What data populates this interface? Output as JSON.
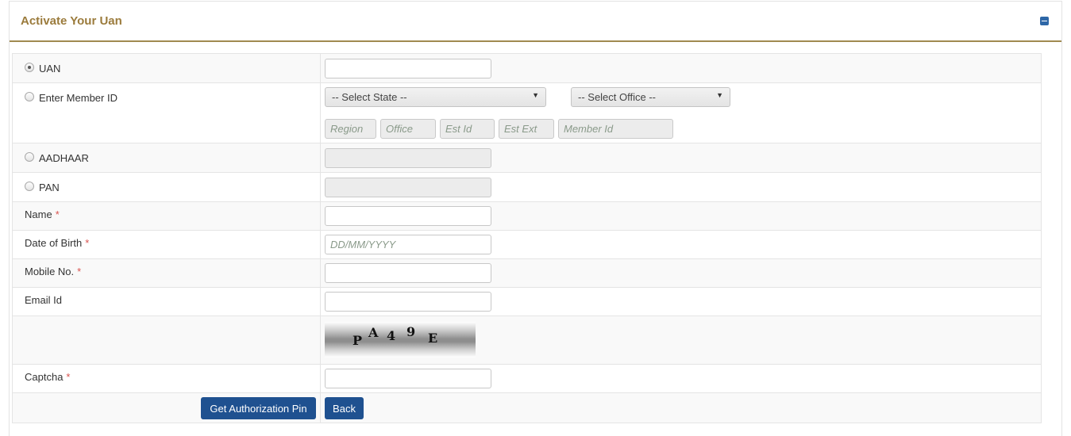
{
  "panel": {
    "title": "Activate Your Uan",
    "collapse_icon": "minus-square-icon"
  },
  "form": {
    "uan": {
      "label": "UAN",
      "selected": true,
      "value": ""
    },
    "member_id": {
      "label": "Enter Member ID",
      "state_select": "-- Select State --",
      "office_select": "-- Select Office --",
      "region_placeholder": "Region",
      "office_placeholder": "Office",
      "est_id_placeholder": "Est Id",
      "est_ext_placeholder": "Est Ext",
      "member_id_placeholder": "Member Id"
    },
    "aadhaar": {
      "label": "AADHAAR"
    },
    "pan": {
      "label": "PAN"
    },
    "name": {
      "label": "Name",
      "required": "*"
    },
    "dob": {
      "label": "Date of Birth",
      "required": "*",
      "placeholder": "DD/MM/YYYY"
    },
    "mobile": {
      "label": "Mobile No.",
      "required": "*"
    },
    "email": {
      "label": "Email Id"
    },
    "captcha_image": {
      "chars": [
        "P",
        "A",
        "4",
        "9",
        "E"
      ]
    },
    "captcha": {
      "label": "Captcha",
      "required": "*"
    }
  },
  "buttons": {
    "get_pin": "Get Authorization Pin",
    "back": "Back"
  },
  "colors": {
    "title": "#9b7b3c",
    "header_rule": "#a08a50",
    "button": "#1f5190",
    "required": "#d9534f"
  }
}
